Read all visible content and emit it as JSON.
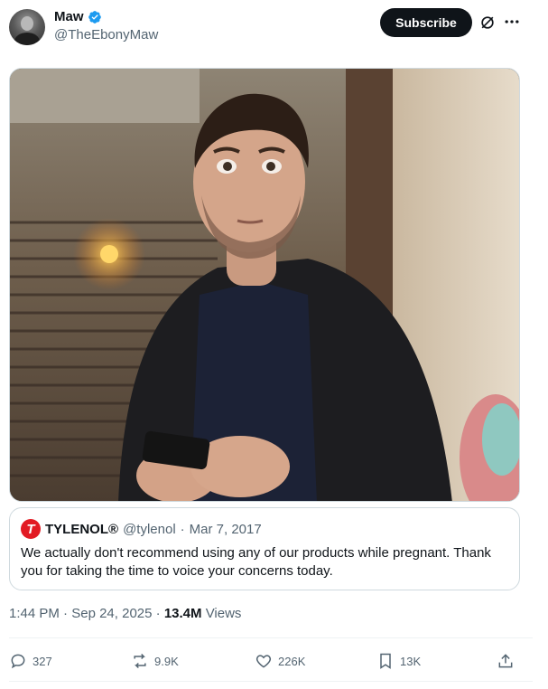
{
  "author": {
    "display_name": "Maw",
    "handle": "@TheEbonyMaw",
    "verified": true
  },
  "header": {
    "subscribe_label": "Subscribe",
    "grok_icon": "grok-icon",
    "more_icon": "more-options-icon"
  },
  "media": {
    "type": "photo",
    "icon": "photo"
  },
  "quoted_tweet": {
    "logo_letter": "T",
    "display_name": "TYLENOL®",
    "handle": "@tylenol",
    "separator": "·",
    "date": "Mar 7, 2017",
    "text": "We actually don't recommend using any of our products while pregnant. Thank you for taking the time to voice your concerns today."
  },
  "meta": {
    "time": "1:44 PM",
    "separator": "·",
    "date": "Sep 24, 2025",
    "views_count": "13.4M",
    "views_label": "Views"
  },
  "actions": {
    "replies": "327",
    "reposts": "9.9K",
    "likes": "226K",
    "bookmarks": "13K"
  },
  "colors": {
    "verified_blue": "#1d9bf0",
    "text_primary": "#0f1419",
    "text_secondary": "#536471",
    "border": "#cfd9de",
    "tylenol_red": "#e21a23"
  }
}
